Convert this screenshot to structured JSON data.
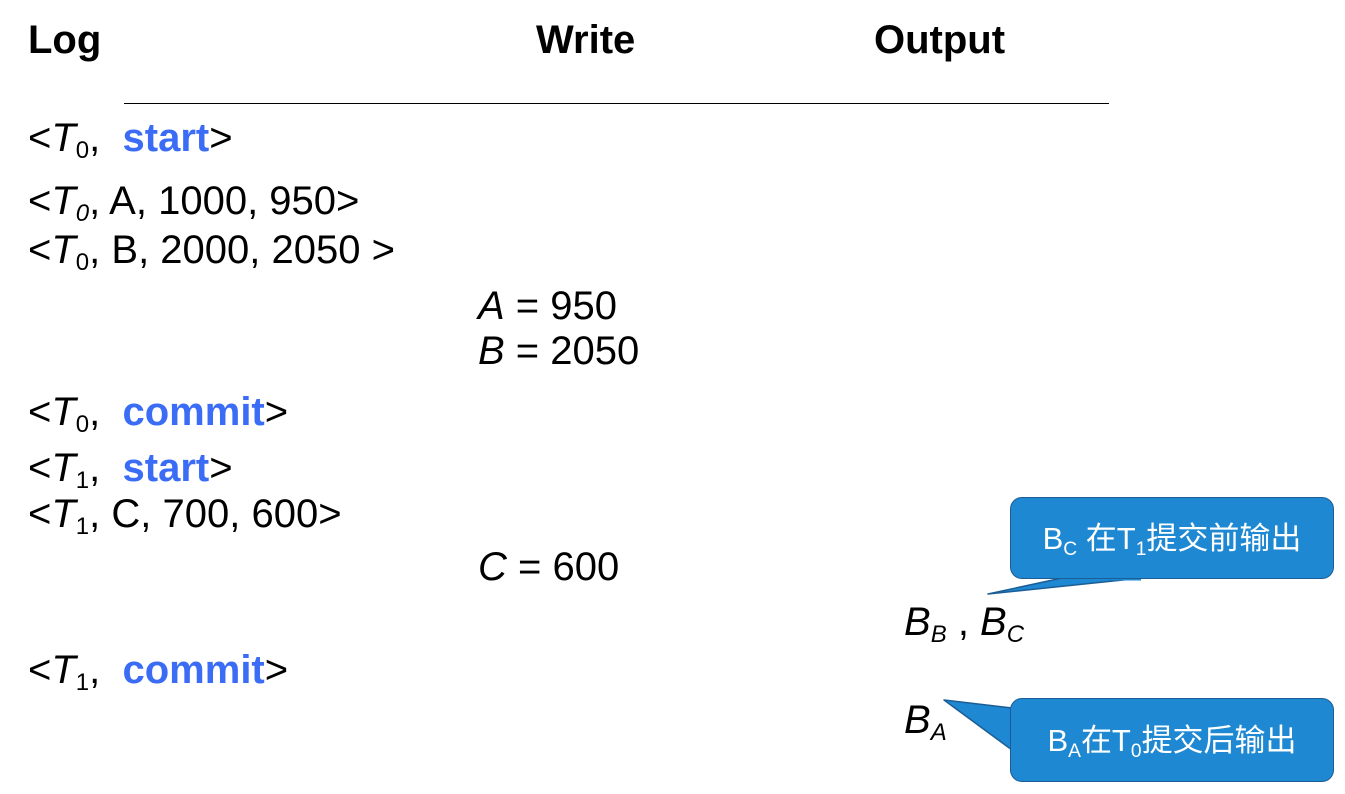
{
  "headers": {
    "log": "Log",
    "write": "Write",
    "output": "Output"
  },
  "log_entries": [
    {
      "pre": "<",
      "txn": "T",
      "sub": "0",
      "rest": ",  ",
      "kw": "start",
      "post": ">"
    },
    {
      "pre": "<",
      "txn": "T",
      "sub": "0",
      "rest": ", A, 1000, 950>",
      "kw": "",
      "post": ""
    },
    {
      "pre": "<",
      "txn": "T",
      "sub": "0",
      "rest": ", B, 2000, 2050 >",
      "kw": "",
      "post": ""
    },
    {
      "pre": "<",
      "txn": "T",
      "sub": "0",
      "rest": ",  ",
      "kw": "commit",
      "post": ">"
    },
    {
      "pre": "<",
      "txn": "T",
      "sub": "1",
      "rest": ",  ",
      "kw": "start",
      "post": ">"
    },
    {
      "pre": "<",
      "txn": "T",
      "sub": "1",
      "rest": ", C, 700, 600>",
      "kw": "",
      "post": ""
    },
    {
      "pre": "<",
      "txn": "T",
      "sub": "1",
      "rest": ",  ",
      "kw": "commit",
      "post": ">"
    }
  ],
  "writes": [
    {
      "var": "A",
      "rest": " = 950"
    },
    {
      "var": "B",
      "rest": " = 2050"
    },
    {
      "var": "C",
      "rest": " = 600"
    }
  ],
  "outputs": [
    {
      "b1": "B",
      "b1_sub": "B",
      "sep": " , ",
      "b2": "B",
      "b2_sub": "C"
    },
    {
      "b1": "B",
      "b1_sub": "A"
    }
  ],
  "callouts": [
    {
      "b": "B",
      "b_sub": "C",
      "mid": " 在T",
      "t_sub": "1",
      "tail": "提交前输出"
    },
    {
      "b": "B",
      "b_sub": "A",
      "mid": "在T",
      "t_sub": "0",
      "tail": "提交后输出"
    }
  ],
  "colors": {
    "keyword": "#3b6cf5",
    "callout_fill": "#1e88d2",
    "callout_border": "#1b5e96"
  }
}
